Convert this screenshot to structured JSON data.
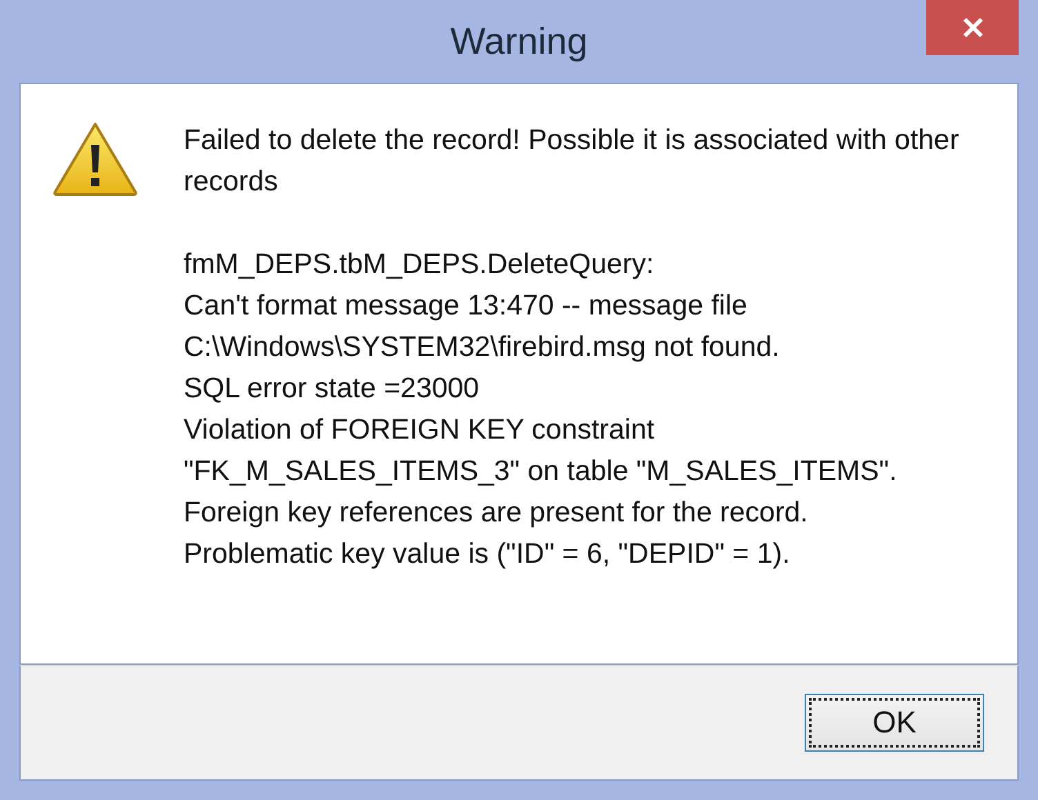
{
  "window": {
    "title": "Warning"
  },
  "message": "Failed to delete the record! Possible it is associated with other records",
  "details": [
    "fmM_DEPS.tbM_DEPS.DeleteQuery:",
    "Can't format message 13:470 -- message file",
    "C:\\Windows\\SYSTEM32\\firebird.msg not found.",
    "SQL error state =23000",
    "Violation of FOREIGN KEY constraint",
    "\"FK_M_SALES_ITEMS_3\" on table \"M_SALES_ITEMS\".",
    "Foreign key references are present for the record.",
    "Problematic key value is (\"ID\" = 6, \"DEPID\" = 1)."
  ],
  "buttons": [
    {
      "label": "OK",
      "focused": true
    }
  ]
}
